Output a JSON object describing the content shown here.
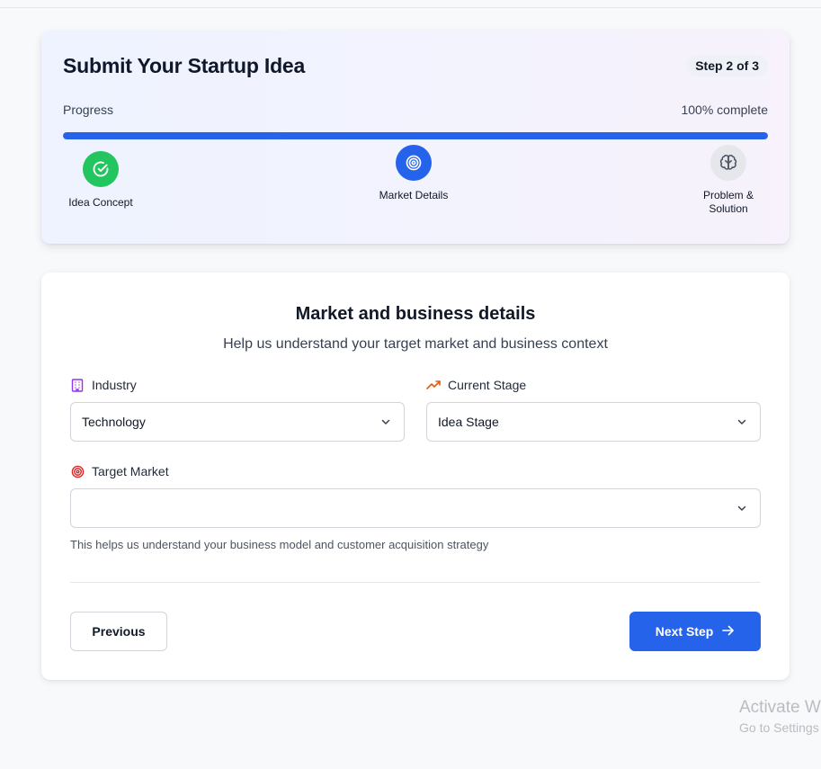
{
  "header": {
    "title": "Submit Your Startup Idea",
    "step_badge": "Step 2 of 3",
    "progress_label": "Progress",
    "progress_percent_text": "100% complete",
    "progress_value": 1.0,
    "steps": [
      {
        "label": "Idea Concept",
        "status": "completed",
        "icon": "check-circle-icon",
        "color": "#22c55e"
      },
      {
        "label": "Market Details",
        "status": "current",
        "icon": "target-icon",
        "color": "#2563eb"
      },
      {
        "label": "Problem & Solution",
        "status": "upcoming",
        "icon": "brain-icon",
        "color": "#e5e7eb"
      }
    ]
  },
  "form": {
    "title": "Market and business details",
    "subtitle": "Help us understand your target market and business context",
    "industry": {
      "label": "Industry",
      "value": "Technology",
      "icon": "building-icon"
    },
    "current_stage": {
      "label": "Current Stage",
      "value": "Idea Stage",
      "icon": "trending-up-icon"
    },
    "target_market": {
      "label": "Target Market",
      "value": "",
      "icon": "target-icon"
    },
    "helper_text": "This helps us understand your business model and customer acquisition strategy",
    "previous_label": "Previous",
    "next_label": "Next Step"
  },
  "watermark": {
    "title": "Activate W",
    "subtitle": "Go to Settings"
  },
  "colors": {
    "accent": "#2563eb",
    "success": "#22c55e",
    "industry_icon": "#9333ea",
    "stage_icon": "#ea580c",
    "target_icon": "#dc2626"
  }
}
